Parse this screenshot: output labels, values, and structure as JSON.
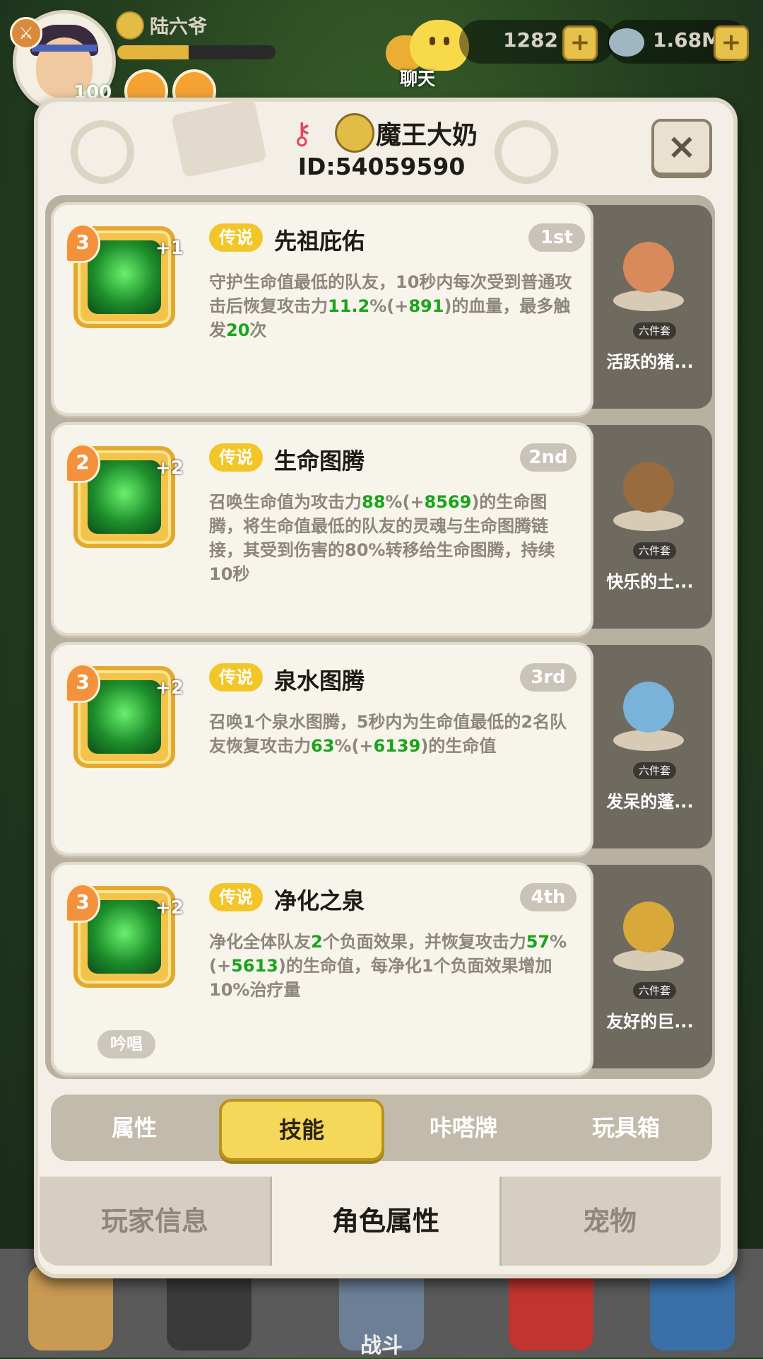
{
  "hud": {
    "player_name": "陆六爷",
    "level": "100",
    "exp_fraction": 0.45,
    "chat_label": "聊天",
    "currency1": "1282",
    "currency2": "1.68M"
  },
  "modal": {
    "name": "魔王大奶",
    "id_text": "ID:54059590",
    "close_label": "×"
  },
  "skills": [
    {
      "level": "3",
      "plus": "+1",
      "rarity": "传说",
      "name": "先祖庇佑",
      "rank": "1st",
      "desc": [
        {
          "t": "守护生命值最低的队友，10秒内每次受到普通攻击后恢复攻击力",
          "g": false
        },
        {
          "t": "11.2",
          "g": true
        },
        {
          "t": "%(+",
          "g": false
        },
        {
          "t": "891",
          "g": true
        },
        {
          "t": ")的血量，最多触发",
          "g": false
        },
        {
          "t": "20",
          "g": true
        },
        {
          "t": "次",
          "g": false
        }
      ],
      "chant": "",
      "set_tag": "六件套",
      "set_name": "活跃的猪..."
    },
    {
      "level": "2",
      "plus": "+2",
      "rarity": "传说",
      "name": "生命图腾",
      "rank": "2nd",
      "desc": [
        {
          "t": "召唤生命值为攻击力",
          "g": false
        },
        {
          "t": "88",
          "g": true
        },
        {
          "t": "%(+",
          "g": false
        },
        {
          "t": "8569",
          "g": true
        },
        {
          "t": ")的生命图腾，将生命值最低的队友的灵魂与生命图腾链接，其受到伤害的80%转移给生命图腾，持续10秒",
          "g": false
        }
      ],
      "chant": "",
      "set_tag": "六件套",
      "set_name": "快乐的土..."
    },
    {
      "level": "3",
      "plus": "+2",
      "rarity": "传说",
      "name": "泉水图腾",
      "rank": "3rd",
      "desc": [
        {
          "t": "召唤1个泉水图腾，5秒内为生命值最低的2名队友恢复攻击力",
          "g": false
        },
        {
          "t": "63",
          "g": true
        },
        {
          "t": "%(+",
          "g": false
        },
        {
          "t": "6139",
          "g": true
        },
        {
          "t": ")的生命值",
          "g": false
        }
      ],
      "chant": "",
      "set_tag": "六件套",
      "set_name": "发呆的蓬..."
    },
    {
      "level": "3",
      "plus": "+2",
      "rarity": "传说",
      "name": "净化之泉",
      "rank": "4th",
      "desc": [
        {
          "t": "净化全体队友",
          "g": false
        },
        {
          "t": "2",
          "g": true
        },
        {
          "t": "个负面效果，并恢复攻击力",
          "g": false
        },
        {
          "t": "57",
          "g": true
        },
        {
          "t": "%(+",
          "g": false
        },
        {
          "t": "5613",
          "g": true
        },
        {
          "t": ")的生命值，每净化1个负面效果增加10%治疗量",
          "g": false
        }
      ],
      "chant": "吟唱",
      "set_tag": "六件套",
      "set_name": "友好的巨..."
    }
  ],
  "subtabs": [
    "属性",
    "技能",
    "咔嗒牌",
    "玩具箱"
  ],
  "subtab_active": "技能",
  "maintabs": [
    "玩家信息",
    "角色属性",
    "宠物"
  ],
  "maintab_active": "角色属性",
  "bottom_nav": {
    "battle": "战斗"
  },
  "colors": {
    "accent_yellow": "#f5d75a",
    "rarity": "#f2c629",
    "value_green": "#19a51a",
    "panel": "#f3efe6"
  }
}
